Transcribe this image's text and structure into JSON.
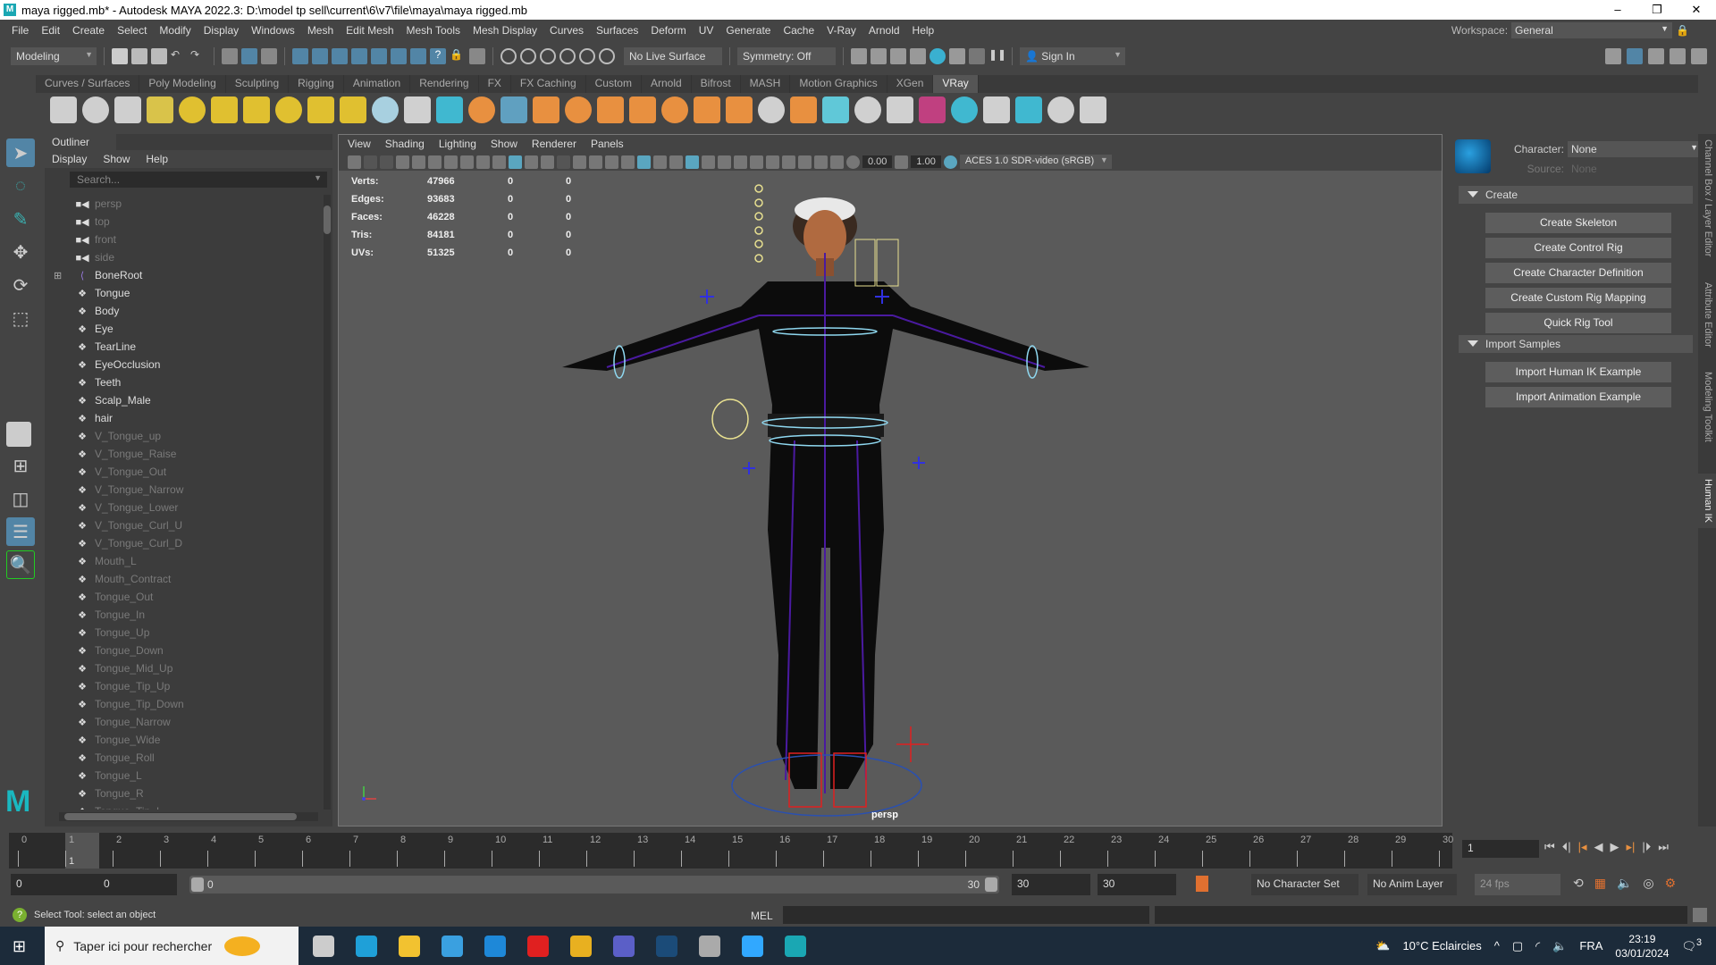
{
  "title": "maya rigged.mb* - Autodesk MAYA 2022.3: D:\\model tp sell\\current\\6\\v7\\file\\maya\\maya rigged.mb",
  "menus": [
    "File",
    "Edit",
    "Create",
    "Select",
    "Modify",
    "Display",
    "Windows",
    "Mesh",
    "Edit Mesh",
    "Mesh Tools",
    "Mesh Display",
    "Curves",
    "Surfaces",
    "Deform",
    "UV",
    "Generate",
    "Cache",
    "V-Ray",
    "Arnold",
    "Help"
  ],
  "workspace": {
    "label": "Workspace:",
    "value": "General"
  },
  "statusline": {
    "mode": "Modeling",
    "live_surface": "No Live Surface",
    "symmetry": "Symmetry: Off",
    "sign_in": "Sign In"
  },
  "shelf_tabs": [
    "Curves / Surfaces",
    "Poly Modeling",
    "Sculpting",
    "Rigging",
    "Animation",
    "Rendering",
    "FX",
    "FX Caching",
    "Custom",
    "Arnold",
    "Bifrost",
    "MASH",
    "Motion Graphics",
    "XGen",
    "VRay"
  ],
  "active_shelf": "VRay",
  "shelf_icons": [
    {
      "name": "vray-render-settings-icon",
      "color": "#cfcfcf"
    },
    {
      "name": "vray-material-icon",
      "color": "#cfcfcf"
    },
    {
      "name": "vray-frame-buffer-icon",
      "color": "#cfcfcf"
    },
    {
      "name": "vray-log-icon",
      "color": "#d9c34a"
    },
    {
      "name": "dome-light-icon",
      "color": "#e0c030"
    },
    {
      "name": "spot-light-icon",
      "color": "#e0c030"
    },
    {
      "name": "sphere-light-icon",
      "color": "#e0c030"
    },
    {
      "name": "ies-light-icon",
      "color": "#e0c030"
    },
    {
      "name": "mesh-light-icon",
      "color": "#e0c030"
    },
    {
      "name": "sun-light-icon",
      "color": "#e0c030"
    },
    {
      "name": "plane-icon",
      "color": "#a8d0e0"
    },
    {
      "name": "proxy-icon",
      "color": "#d0d0d0"
    },
    {
      "name": "proxy-export-icon",
      "color": "#40b8d0"
    },
    {
      "name": "scene-icon",
      "color": "#e89040"
    },
    {
      "name": "fur-icon",
      "color": "#60a0c0"
    },
    {
      "name": "displacement-icon",
      "color": "#e89040"
    },
    {
      "name": "particle-icon",
      "color": "#e89040"
    },
    {
      "name": "grass-icon",
      "color": "#e89040"
    },
    {
      "name": "decal-icon",
      "color": "#e89040"
    },
    {
      "name": "texture-icon",
      "color": "#e89040"
    },
    {
      "name": "uvw-icon",
      "color": "#e89040"
    },
    {
      "name": "sphere-fade-icon",
      "color": "#e89040"
    },
    {
      "name": "clipper-icon",
      "color": "#d0d0d0"
    },
    {
      "name": "settings-gear-icon",
      "color": "#e89040"
    },
    {
      "name": "vray-physical-camera-icon",
      "color": "#60c8d8"
    },
    {
      "name": "material-ball-icon",
      "color": "#d0d0d0"
    },
    {
      "name": "add-attrs-icon",
      "color": "#d0d0d0"
    },
    {
      "name": "color-icon",
      "color": "#c04080"
    },
    {
      "name": "multi-material-icon",
      "color": "#40b8d0"
    },
    {
      "name": "palette-icon",
      "color": "#d0d0d0"
    },
    {
      "name": "layout-icon",
      "color": "#40b8d0"
    },
    {
      "name": "plugin-icon",
      "color": "#d0d0d0"
    },
    {
      "name": "vray-logo-icon",
      "color": "#d0d0d0"
    }
  ],
  "outliner": {
    "title": "Outliner",
    "menus": [
      "Display",
      "Show",
      "Help"
    ],
    "search_placeholder": "Search...",
    "items": [
      {
        "label": "persp",
        "type": "camera",
        "dim": true
      },
      {
        "label": "top",
        "type": "camera",
        "dim": true
      },
      {
        "label": "front",
        "type": "camera",
        "dim": true
      },
      {
        "label": "side",
        "type": "camera",
        "dim": true
      },
      {
        "label": "BoneRoot",
        "type": "joint",
        "dim": false,
        "expandable": true
      },
      {
        "label": "Tongue",
        "type": "mesh",
        "dim": false
      },
      {
        "label": "Body",
        "type": "mesh",
        "dim": false
      },
      {
        "label": "Eye",
        "type": "mesh",
        "dim": false
      },
      {
        "label": "TearLine",
        "type": "mesh",
        "dim": false
      },
      {
        "label": "EyeOcclusion",
        "type": "mesh",
        "dim": false
      },
      {
        "label": "Teeth",
        "type": "mesh",
        "dim": false
      },
      {
        "label": "Scalp_Male",
        "type": "mesh",
        "dim": false
      },
      {
        "label": "hair",
        "type": "mesh",
        "dim": false
      },
      {
        "label": "V_Tongue_up",
        "type": "mesh",
        "dim": true
      },
      {
        "label": "V_Tongue_Raise",
        "type": "mesh",
        "dim": true
      },
      {
        "label": "V_Tongue_Out",
        "type": "mesh",
        "dim": true
      },
      {
        "label": "V_Tongue_Narrow",
        "type": "mesh",
        "dim": true
      },
      {
        "label": "V_Tongue_Lower",
        "type": "mesh",
        "dim": true
      },
      {
        "label": "V_Tongue_Curl_U",
        "type": "mesh",
        "dim": true
      },
      {
        "label": "V_Tongue_Curl_D",
        "type": "mesh",
        "dim": true
      },
      {
        "label": "Mouth_L",
        "type": "mesh",
        "dim": true
      },
      {
        "label": "Mouth_Contract",
        "type": "mesh",
        "dim": true
      },
      {
        "label": "Tongue_Out",
        "type": "mesh",
        "dim": true
      },
      {
        "label": "Tongue_In",
        "type": "mesh",
        "dim": true
      },
      {
        "label": "Tongue_Up",
        "type": "mesh",
        "dim": true
      },
      {
        "label": "Tongue_Down",
        "type": "mesh",
        "dim": true
      },
      {
        "label": "Tongue_Mid_Up",
        "type": "mesh",
        "dim": true
      },
      {
        "label": "Tongue_Tip_Up",
        "type": "mesh",
        "dim": true
      },
      {
        "label": "Tongue_Tip_Down",
        "type": "mesh",
        "dim": true
      },
      {
        "label": "Tongue_Narrow",
        "type": "mesh",
        "dim": true
      },
      {
        "label": "Tongue_Wide",
        "type": "mesh",
        "dim": true
      },
      {
        "label": "Tongue_Roll",
        "type": "mesh",
        "dim": true
      },
      {
        "label": "Tongue_L",
        "type": "mesh",
        "dim": true
      },
      {
        "label": "Tongue_R",
        "type": "mesh",
        "dim": true
      },
      {
        "label": "Tongue_Tip_L",
        "type": "mesh",
        "dim": true
      }
    ]
  },
  "viewport": {
    "menus": [
      "View",
      "Shading",
      "Lighting",
      "Show",
      "Renderer",
      "Panels"
    ],
    "exposure": "0.00",
    "gamma": "1.00",
    "color_space": "ACES 1.0 SDR-video (sRGB)",
    "camera": "persp",
    "hud": [
      {
        "label": "Verts:",
        "values": [
          "47966",
          "0",
          "0"
        ]
      },
      {
        "label": "Edges:",
        "values": [
          "93683",
          "0",
          "0"
        ]
      },
      {
        "label": "Faces:",
        "values": [
          "46228",
          "0",
          "0"
        ]
      },
      {
        "label": "Tris:",
        "values": [
          "84181",
          "0",
          "0"
        ]
      },
      {
        "label": "UVs:",
        "values": [
          "51325",
          "0",
          "0"
        ]
      }
    ]
  },
  "humanik": {
    "character_label": "Character:",
    "character": "None",
    "source_label": "Source:",
    "source": "None",
    "create_section": "Create",
    "create_buttons": [
      "Create Skeleton",
      "Create Control Rig",
      "Create Character Definition",
      "Create Custom Rig Mapping",
      "Quick Rig Tool"
    ],
    "import_section": "Import Samples",
    "import_buttons": [
      "Import Human IK Example",
      "Import Animation Example"
    ]
  },
  "side_tabs": [
    "Channel Box / Layer Editor",
    "Attribute Editor",
    "Modeling Toolkit",
    "Human IK"
  ],
  "timeline": {
    "start": 0,
    "end": 30,
    "current": 1,
    "current_label": "1",
    "frame_field": "1"
  },
  "range": {
    "anim_start": "0",
    "start": "0",
    "slider_start": "0",
    "slider_end": "30",
    "end": "30",
    "anim_end": "30",
    "character_set": "No Character Set",
    "anim_layer": "No Anim Layer",
    "fps": "24 fps"
  },
  "command": {
    "help": "Select Tool: select an object",
    "lang": "MEL"
  },
  "taskbar": {
    "search": "Taper ici pour rechercher",
    "weather": "10°C  Eclaircies",
    "lang": "FRA",
    "time": "23:19",
    "date": "03/01/2024",
    "notifications": "3",
    "apps": [
      {
        "name": "task-view-icon",
        "color": "#cccccc"
      },
      {
        "name": "edge-icon",
        "color": "#1fa0d8"
      },
      {
        "name": "file-explorer-icon",
        "color": "#f2c230"
      },
      {
        "name": "store-icon",
        "color": "#3aa0e0"
      },
      {
        "name": "mail-icon",
        "color": "#1e88d8"
      },
      {
        "name": "opera-icon",
        "color": "#e02020"
      },
      {
        "name": "chrome-icon",
        "color": "#e8b020"
      },
      {
        "name": "teams-icon",
        "color": "#5b5fc7"
      },
      {
        "name": "steam-icon",
        "color": "#1b4b78"
      },
      {
        "name": "generic-app-icon",
        "color": "#aaaaaa"
      },
      {
        "name": "photoshop-icon",
        "color": "#31a8ff"
      },
      {
        "name": "maya-icon",
        "color": "#1aa7b3"
      }
    ]
  }
}
